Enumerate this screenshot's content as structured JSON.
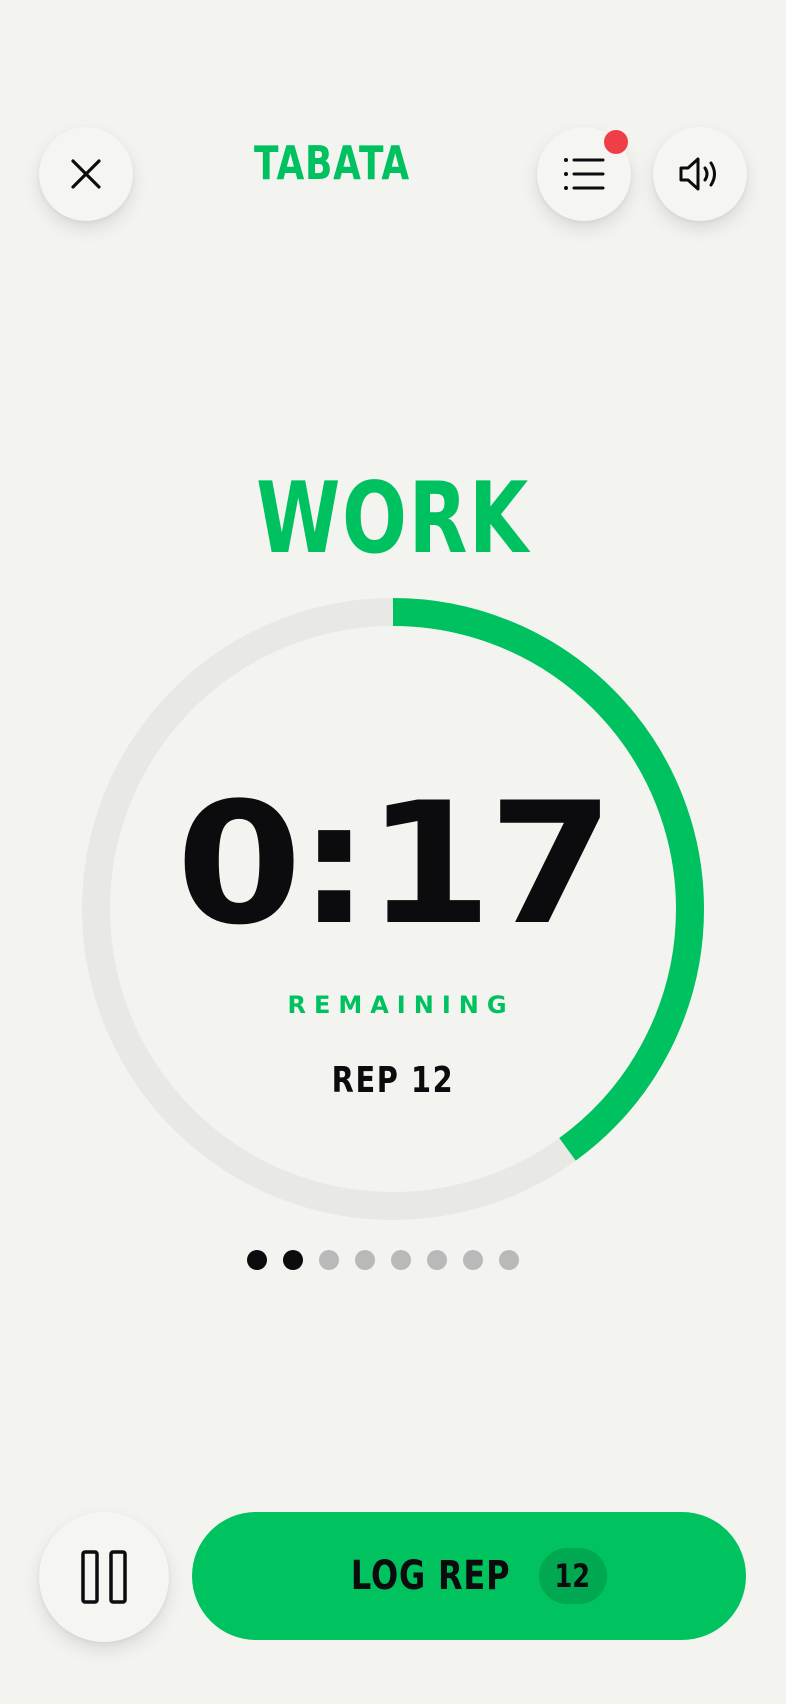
{
  "header": {
    "title": "TABATA",
    "has_notification": true
  },
  "session": {
    "phase": "WORK",
    "time_remaining": "0:17",
    "remaining_label": "REMAINING",
    "rep_label": "REP 12",
    "progress_fraction": 0.4,
    "rounds_total": 8,
    "rounds_completed": 2
  },
  "actions": {
    "log_label": "LOG REP",
    "log_count": "12"
  },
  "colors": {
    "accent": "#00c15f",
    "track": "#e8e8e4",
    "text": "#0c0c0e",
    "notification": "#ef3e47"
  },
  "icons": {
    "close": "close-icon",
    "list": "list-icon",
    "sound": "volume-icon",
    "pause": "pause-icon"
  }
}
